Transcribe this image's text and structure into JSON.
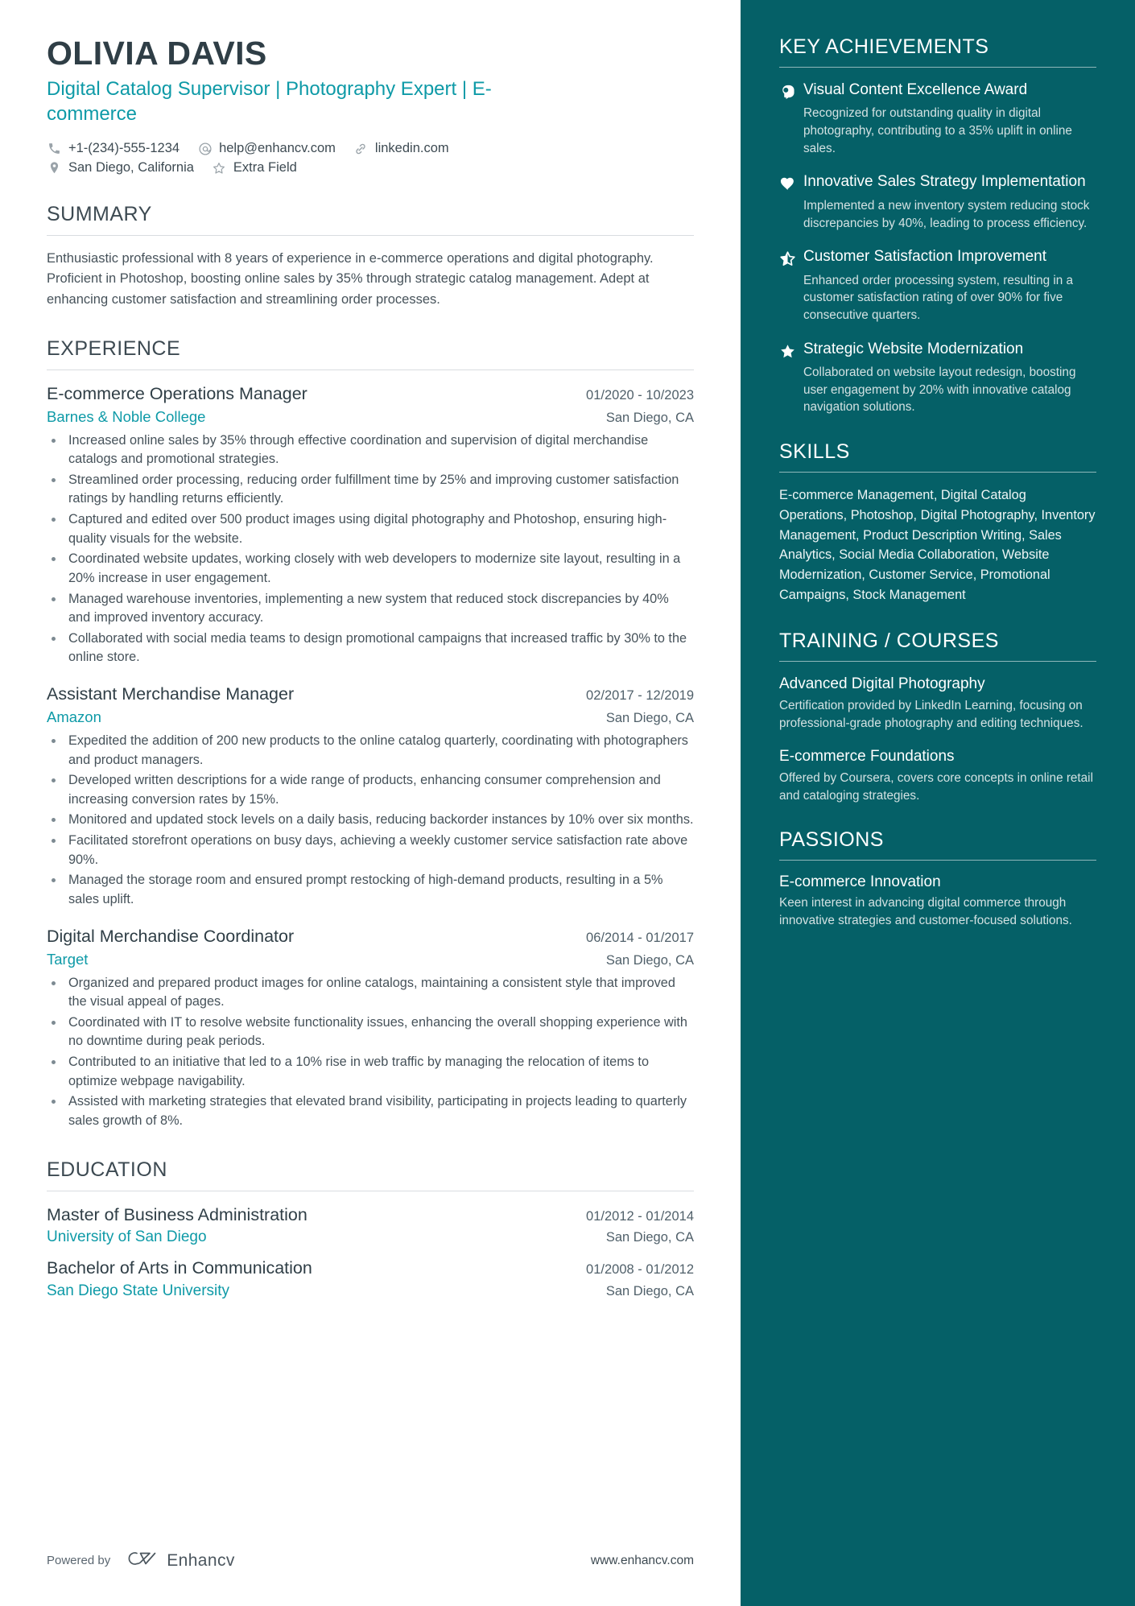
{
  "colors": {
    "accent_teal": "#0e9aa7",
    "sidebar_bg": "#056067",
    "heading_dark": "#2f3e46",
    "body_text": "#46525a"
  },
  "header": {
    "name": "OLIVIA DAVIS",
    "headline": "Digital Catalog Supervisor | Photography Expert | E-commerce",
    "contacts_row1": [
      {
        "icon": "phone-icon",
        "text": "+1-(234)-555-1234"
      },
      {
        "icon": "email-icon",
        "text": "help@enhancv.com"
      },
      {
        "icon": "link-icon",
        "text": "linkedin.com"
      }
    ],
    "contacts_row2": [
      {
        "icon": "location-pin-icon",
        "text": "San Diego, California"
      },
      {
        "icon": "star-outline-icon",
        "text": "Extra Field"
      }
    ]
  },
  "summary": {
    "title": "SUMMARY",
    "text": "Enthusiastic professional with 8 years of experience in e-commerce operations and digital photography. Proficient in Photoshop, boosting online sales by 35% through strategic catalog management. Adept at enhancing customer satisfaction and streamlining order processes."
  },
  "experience": {
    "title": "EXPERIENCE",
    "entries": [
      {
        "title": "E-commerce Operations Manager",
        "dates": "01/2020 - 10/2023",
        "org": "Barnes & Noble College",
        "location": "San Diego, CA",
        "bullets": [
          "Increased online sales by 35% through effective coordination and supervision of digital merchandise catalogs and promotional strategies.",
          "Streamlined order processing, reducing order fulfillment time by 25% and improving customer satisfaction ratings by handling returns efficiently.",
          "Captured and edited over 500 product images using digital photography and Photoshop, ensuring high-quality visuals for the website.",
          "Coordinated website updates, working closely with web developers to modernize site layout, resulting in a 20% increase in user engagement.",
          "Managed warehouse inventories, implementing a new system that reduced stock discrepancies by 40% and improved inventory accuracy.",
          "Collaborated with social media teams to design promotional campaigns that increased traffic by 30% to the online store."
        ]
      },
      {
        "title": "Assistant Merchandise Manager",
        "dates": "02/2017 - 12/2019",
        "org": "Amazon",
        "location": "San Diego, CA",
        "bullets": [
          "Expedited the addition of 200 new products to the online catalog quarterly, coordinating with photographers and product managers.",
          "Developed written descriptions for a wide range of products, enhancing consumer comprehension and increasing conversion rates by 15%.",
          "Monitored and updated stock levels on a daily basis, reducing backorder instances by 10% over six months.",
          "Facilitated storefront operations on busy days, achieving a weekly customer service satisfaction rate above 90%.",
          "Managed the storage room and ensured prompt restocking of high-demand products, resulting in a 5% sales uplift."
        ]
      },
      {
        "title": "Digital Merchandise Coordinator",
        "dates": "06/2014 - 01/2017",
        "org": "Target",
        "location": "San Diego, CA",
        "bullets": [
          "Organized and prepared product images for online catalogs, maintaining a consistent style that improved the visual appeal of pages.",
          "Coordinated with IT to resolve website functionality issues, enhancing the overall shopping experience with no downtime during peak periods.",
          "Contributed to an initiative that led to a 10% rise in web traffic by managing the relocation of items to optimize webpage navigability.",
          "Assisted with marketing strategies that elevated brand visibility, participating in projects leading to quarterly sales growth of 8%."
        ]
      }
    ]
  },
  "education": {
    "title": "EDUCATION",
    "entries": [
      {
        "title": "Master of Business Administration",
        "dates": "01/2012 - 01/2014",
        "org": "University of San Diego",
        "location": "San Diego, CA"
      },
      {
        "title": "Bachelor of Arts in Communication",
        "dates": "01/2008 - 01/2012",
        "org": "San Diego State University",
        "location": "San Diego, CA"
      }
    ]
  },
  "footer": {
    "powered_by": "Powered by",
    "brand_name": "Enhancv",
    "site": "www.enhancv.com"
  },
  "sidebar": {
    "achievements": {
      "title": "KEY ACHIEVEMENTS",
      "items": [
        {
          "icon": "head-profile-icon",
          "title": "Visual Content Excellence Award",
          "desc": "Recognized for outstanding quality in digital photography, contributing to a 35% uplift in online sales."
        },
        {
          "icon": "heart-icon",
          "title": "Innovative Sales Strategy Implementation",
          "desc": "Implemented a new inventory system reducing stock discrepancies by 40%, leading to process efficiency."
        },
        {
          "icon": "half-star-icon",
          "title": "Customer Satisfaction Improvement",
          "desc": "Enhanced order processing system, resulting in a customer satisfaction rating of over 90% for five consecutive quarters."
        },
        {
          "icon": "star-icon",
          "title": "Strategic Website Modernization",
          "desc": "Collaborated on website layout redesign, boosting user engagement by 20% with innovative catalog navigation solutions."
        }
      ]
    },
    "skills": {
      "title": "SKILLS",
      "text": "E-commerce Management, Digital Catalog Operations, Photoshop, Digital Photography, Inventory Management, Product Description Writing, Sales Analytics, Social Media Collaboration, Website Modernization, Customer Service, Promotional Campaigns, Stock Management"
    },
    "training": {
      "title": "TRAINING / COURSES",
      "items": [
        {
          "title": "Advanced Digital Photography",
          "desc": "Certification provided by LinkedIn Learning, focusing on professional-grade photography and editing techniques."
        },
        {
          "title": "E-commerce Foundations",
          "desc": "Offered by Coursera, covers core concepts in online retail and cataloging strategies."
        }
      ]
    },
    "passions": {
      "title": "PASSIONS",
      "items": [
        {
          "title": "E-commerce Innovation",
          "desc": "Keen interest in advancing digital commerce through innovative strategies and customer-focused solutions."
        }
      ]
    }
  }
}
